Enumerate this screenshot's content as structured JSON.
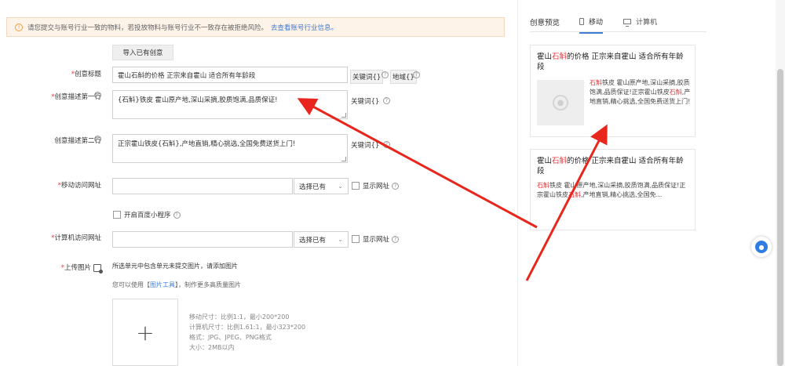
{
  "notice": {
    "text": "请您提交与账号行业一致的物料，若投放物料与账号行业不一致存在被拒绝风险。",
    "link": "去查看账号行业信息。"
  },
  "import_button": "导入已有创意",
  "title_row": {
    "label": "创意标题",
    "value": "霍山石斛的价格 正宗来自霍山 适合所有年龄段",
    "keyword_btn": "关键词{}",
    "region_btn": "地域{}"
  },
  "desc1_row": {
    "label": "创意描述第一行",
    "value": "{石斛}铁皮 霍山原产地,深山采摘,胶质饱满,品质保证!",
    "keyword_btn": "关键词{}"
  },
  "desc2_row": {
    "label": "创意描述第二行",
    "value": "正宗霍山铁皮{石斛},产地直销,精心挑选,全国免费送货上门!",
    "keyword_btn": "关键词{}"
  },
  "mobile_url_row": {
    "label": "移动访问网址",
    "value": "",
    "select_label": "选择已有",
    "show_url": "显示网址"
  },
  "mini_program": "开启百度小程序",
  "pc_url_row": {
    "label": "计算机访问网址",
    "value": "",
    "select_label": "选择已有",
    "show_url": "显示网址"
  },
  "upload": {
    "label": "上传图片",
    "note": "所选单元中包含单元未提交图片，请添加图片",
    "tool_prefix": "您可以使用【",
    "tool_link": "图片工具",
    "tool_suffix": "】，制作更多高质量图片",
    "plus": "+",
    "specs": [
      "移动尺寸：比例1:1，最小200*200",
      "计算机尺寸：比例1.61:1，最小323*200",
      "格式：JPG、JPEG、PNG格式",
      "大小：2MB以内"
    ]
  },
  "preview": {
    "title": "创意预览",
    "tab_mobile": "移动",
    "tab_pc": "计算机",
    "card1": {
      "title_a": "霍山",
      "title_red": "石斛",
      "title_b": "的价格 正宗来自霍山 适合所有年龄段",
      "desc_red1": "石斛",
      "desc_a": "铁皮 霍山原产地,深山采摘,胶质饱满,品质保证!正宗霍山铁皮",
      "desc_red2": "石斛",
      "desc_b": ",产地直销,精心挑选,全国免费送货上门!"
    },
    "card2": {
      "title_a": "霍山",
      "title_red": "石斛",
      "title_b": "的价格 正宗来自霍山 适合所有年龄段",
      "desc_red1": "石斛",
      "desc_a": "铁皮 霍山原产地,深山采摘,胶质饱满,品质保证!正宗霍山铁皮",
      "desc_red2": "石斛",
      "desc_b": ",产地直销,精心挑选,全国免..."
    }
  },
  "colors": {
    "accent_blue": "#3c7bd6",
    "required_red": "#e6393d",
    "annotation_arrow": "#e8261d"
  }
}
